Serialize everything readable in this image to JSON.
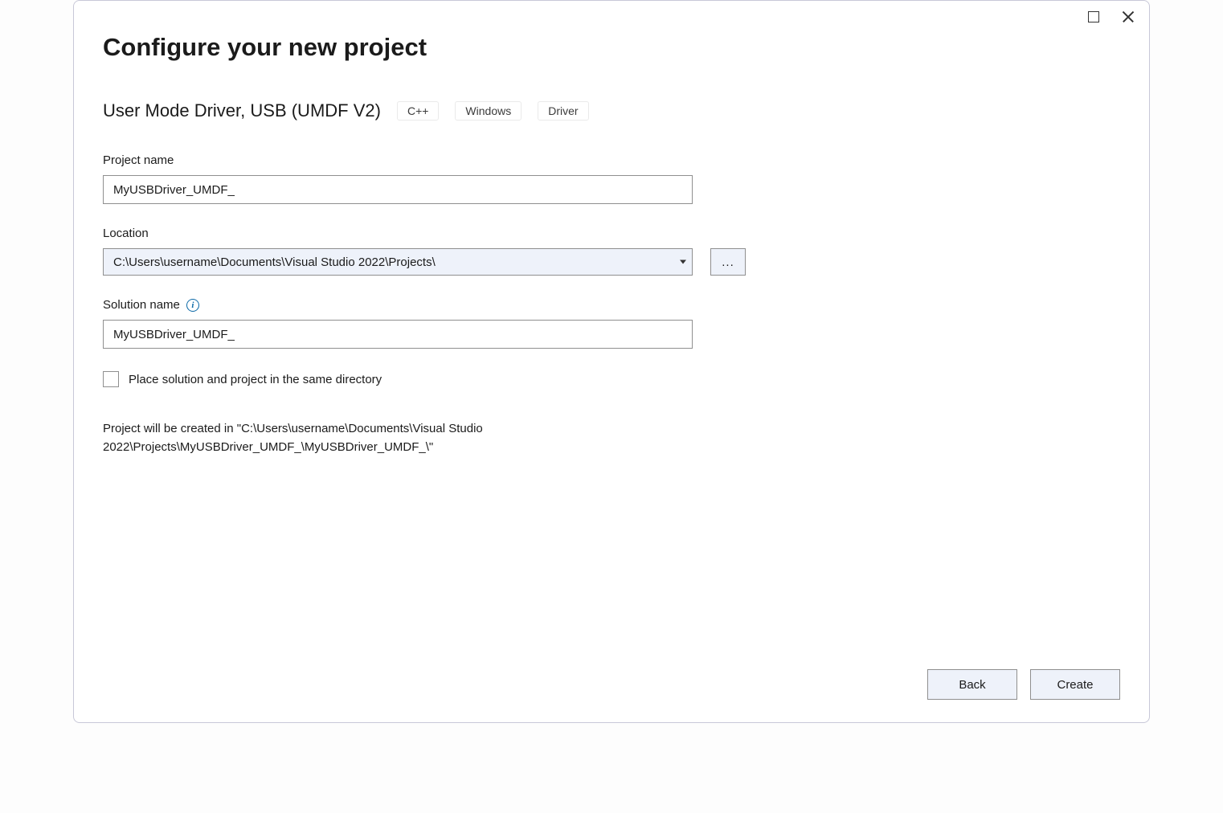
{
  "window": {
    "title": "Configure your new project"
  },
  "template": {
    "name": "User Mode Driver, USB (UMDF V2)",
    "tags": [
      "C++",
      "Windows",
      "Driver"
    ]
  },
  "fields": {
    "projectName": {
      "label": "Project name",
      "value": "MyUSBDriver_UMDF_"
    },
    "location": {
      "label": "Location",
      "value": "C:\\Users\\username\\Documents\\Visual Studio 2022\\Projects\\",
      "browseLabel": "..."
    },
    "solutionName": {
      "label": "Solution name",
      "value": "MyUSBDriver_UMDF_"
    },
    "sameDirectory": {
      "label": "Place solution and project in the same directory",
      "checked": false
    }
  },
  "creationMessage": "Project will be created in \"C:\\Users\\username\\Documents\\Visual Studio 2022\\Projects\\MyUSBDriver_UMDF_\\MyUSBDriver_UMDF_\\\"",
  "buttons": {
    "back": "Back",
    "create": "Create"
  }
}
